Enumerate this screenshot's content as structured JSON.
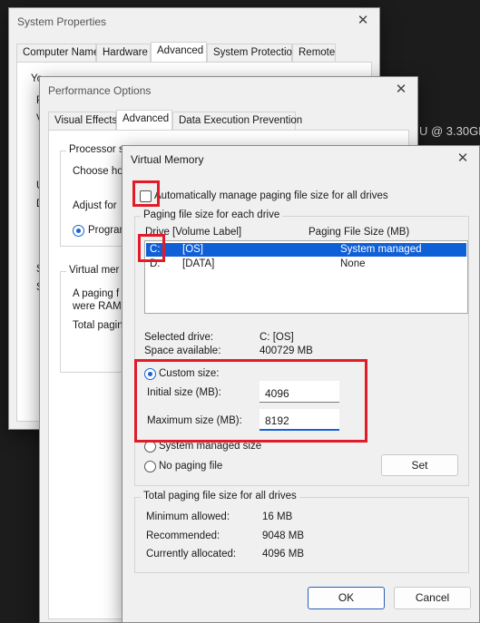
{
  "background": {
    "cpu_text": "U @ 3.30GH"
  },
  "system_properties": {
    "title": "System Properties",
    "tabs": [
      "Computer Name",
      "Hardware",
      "Advanced",
      "System Protection",
      "Remote"
    ],
    "peek": {
      "line1": "Yo",
      "line2": "P",
      "line3": "V",
      "line4": "U",
      "line5": "D",
      "line6": "S",
      "line7": "S"
    }
  },
  "performance_options": {
    "title": "Performance Options",
    "tabs": [
      "Visual Effects",
      "Advanced",
      "Data Execution Prevention"
    ],
    "processor_group": "Processor s",
    "choose": "Choose ho",
    "adjust": "Adjust for",
    "programs": "Program",
    "vm_group": "Virtual mer",
    "paging1": "A paging f",
    "paging2": "were RAM",
    "total": "Total pagin"
  },
  "virtual_memory": {
    "title": "Virtual Memory",
    "auto_manage_label": "Automatically manage paging file size for all drives",
    "auto_manage_checked": false,
    "paging_group": "Paging file size for each drive",
    "col_drive": "Drive  [Volume Label]",
    "col_size": "Paging File Size (MB)",
    "drives": [
      {
        "letter": "C:",
        "label": "[OS]",
        "size": "System managed",
        "selected": true
      },
      {
        "letter": "D:",
        "label": "[DATA]",
        "size": "None",
        "selected": false
      }
    ],
    "selected_drive_label": "Selected drive:",
    "selected_drive_value": "C:  [OS]",
    "space_available_label": "Space available:",
    "space_available_value": "400729 MB",
    "custom_size_label": "Custom size:",
    "initial_size_label": "Initial size (MB):",
    "initial_size_value": "4096",
    "maximum_size_label": "Maximum size (MB):",
    "maximum_size_value": "8192",
    "system_managed_label": "System managed size",
    "no_paging_label": "No paging file",
    "set_label": "Set",
    "total_group": "Total paging file size for all drives",
    "minimum_label": "Minimum allowed:",
    "minimum_value": "16 MB",
    "recommended_label": "Recommended:",
    "recommended_value": "9048 MB",
    "allocated_label": "Currently allocated:",
    "allocated_value": "4096 MB",
    "ok_label": "OK",
    "cancel_label": "Cancel",
    "selected_option": "custom"
  },
  "colors": {
    "highlight": "#e01c28",
    "accent": "#0f5fd7"
  }
}
